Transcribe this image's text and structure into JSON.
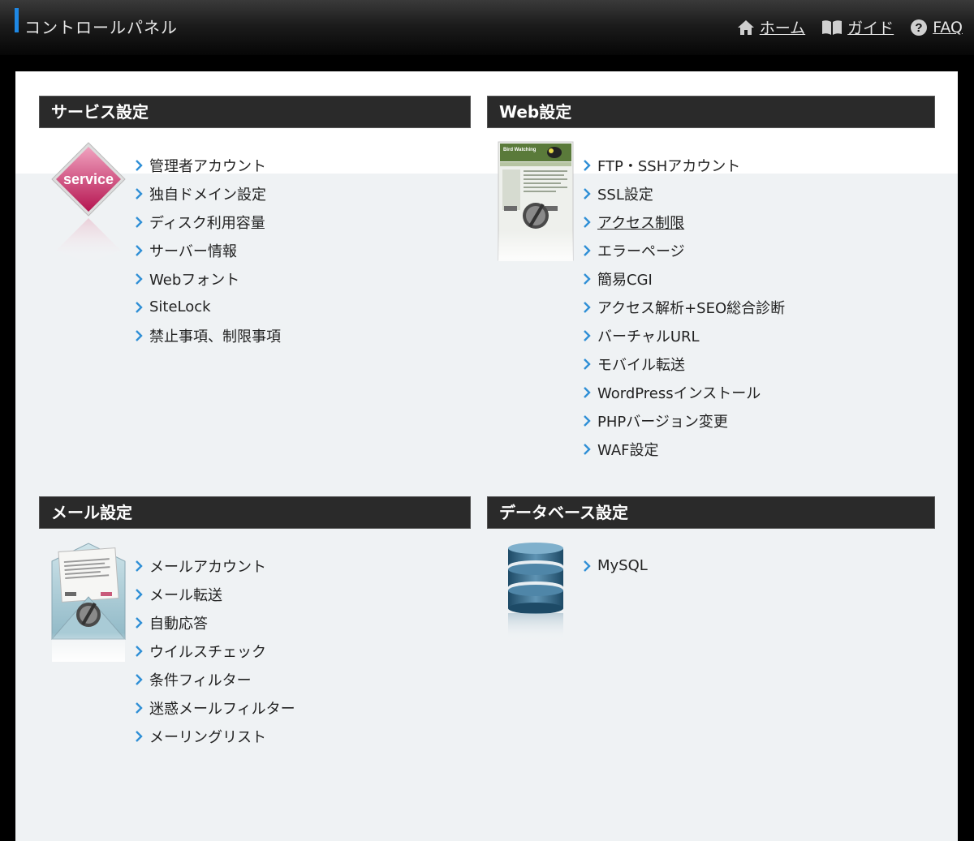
{
  "header": {
    "title": "コントロールパネル",
    "nav": [
      {
        "label": "ホーム",
        "icon": "home-icon"
      },
      {
        "label": "ガイド",
        "icon": "book-icon"
      },
      {
        "label": "FAQ",
        "icon": "help-icon"
      }
    ]
  },
  "sections": {
    "service": {
      "title": "サービス設定",
      "icon_text": "service",
      "items": [
        "管理者アカウント",
        "独自ドメイン設定",
        "ディスク利用容量",
        "サーバー情報",
        "Webフォント",
        "SiteLock",
        "禁止事項、制限事項"
      ]
    },
    "web": {
      "title": "Web設定",
      "icon_text": "Bird Watching",
      "items": [
        "FTP・SSHアカウント",
        "SSL設定",
        "アクセス制限",
        "エラーページ",
        "簡易CGI",
        "アクセス解析+SEO総合診断",
        "バーチャルURL",
        "モバイル転送",
        "WordPressインストール",
        "PHPバージョン変更",
        "WAF設定"
      ]
    },
    "mail": {
      "title": "メール設定",
      "items": [
        "メールアカウント",
        "メール転送",
        "自動応答",
        "ウイルスチェック",
        "条件フィルター",
        "迷惑メールフィルター",
        "メーリングリスト"
      ]
    },
    "database": {
      "title": "データベース設定",
      "items": [
        "MySQL"
      ]
    }
  },
  "colors": {
    "accent": "#1e88e5",
    "chevron": "#2f8fd6",
    "header_bg": "#2a2a2a",
    "panel_bg": "#eff2f4"
  }
}
